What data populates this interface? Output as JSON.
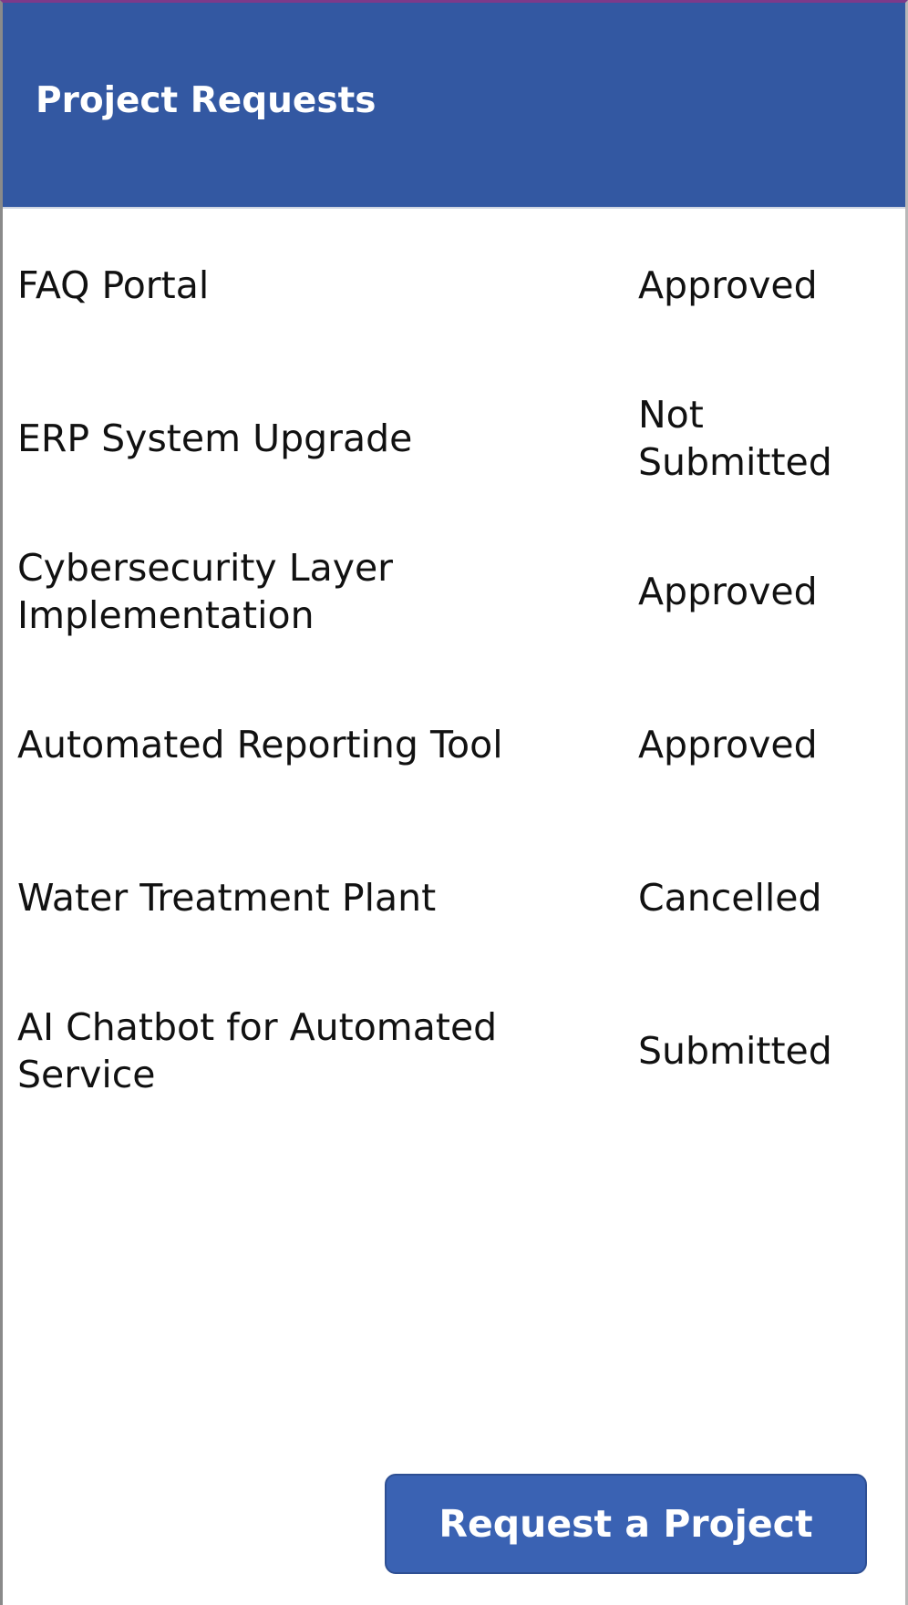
{
  "header": {
    "title": "Project Requests"
  },
  "projects": [
    {
      "title": "FAQ Portal",
      "status": "Approved"
    },
    {
      "title": "ERP System Upgrade",
      "status": "Not Submitted"
    },
    {
      "title": "Cybersecurity Layer Implementation",
      "status": "Approved"
    },
    {
      "title": "Automated Reporting Tool",
      "status": "Approved"
    },
    {
      "title": "Water Treatment Plant",
      "status": "Cancelled"
    },
    {
      "title": "AI Chatbot for Automated Service",
      "status": "Submitted"
    }
  ],
  "actions": {
    "request_label": "Request a Project"
  },
  "colors": {
    "header_bg": "#3358a2",
    "button_bg": "#3a62b3",
    "text": "#111111"
  }
}
